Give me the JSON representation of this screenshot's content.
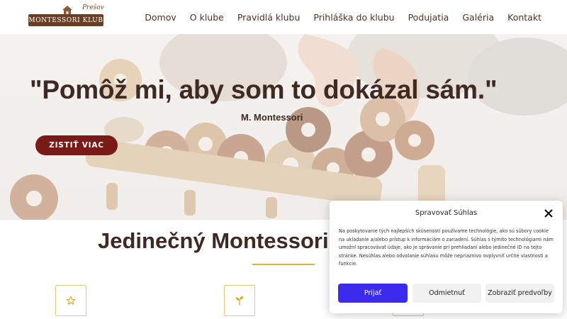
{
  "logo": {
    "name": "MONTESSORI KLUB",
    "location": "Prešov"
  },
  "nav": {
    "items": [
      {
        "label": "Domov"
      },
      {
        "label": "O klube"
      },
      {
        "label": "Pravidlá klubu"
      },
      {
        "label": "Prihláška do klubu"
      },
      {
        "label": "Podujatia"
      },
      {
        "label": "Galéria"
      },
      {
        "label": "Kontakt"
      }
    ]
  },
  "hero": {
    "quote": "\"Pomôž mi, aby som to dokázal sám.\"",
    "author": "M. Montessori",
    "cta_label": "ZISTIŤ VIAC"
  },
  "section": {
    "title": "Jedinečný Montessori klub",
    "features": [
      {
        "icon": "star-icon"
      },
      {
        "icon": "sprout-icon"
      },
      {
        "icon": "feature-icon"
      }
    ]
  },
  "consent": {
    "title": "Spravovať Súhlas",
    "text": "Na poskytovanie tých najlepších skúseností používame technológie, ako sú súbory cookie na ukladanie a/alebo prístup k informáciám o zariadení. Súhlas s týmito technológiami nám umožní spracovávať údaje, ako je správanie pri prehliadaní alebo jedinečné ID na tejto stránke. Nesúhlas alebo odvolanie súhlasu môže nepriaznivo ovplyvniť určité vlastnosti a funkcie.",
    "accept_label": "Prijať",
    "deny_label": "Odmietnuť",
    "prefs_label": "Zobraziť predvoľby",
    "close_icon": "close-icon"
  },
  "colors": {
    "brand_brown": "#3e2a22",
    "cta_red": "#7a1a16",
    "accent_gold": "#e3b23c",
    "accept_blue": "#3b2bea"
  }
}
